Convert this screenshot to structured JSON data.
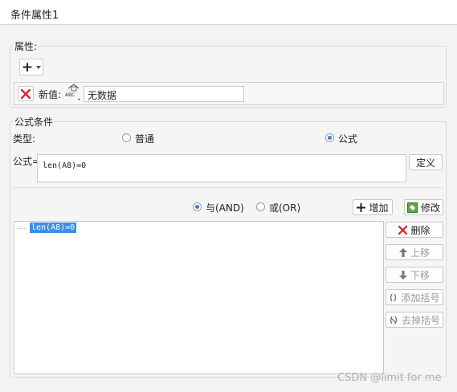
{
  "tab": {
    "title": "条件属性1"
  },
  "attributes": {
    "legend": "属性:",
    "add_symbol": "+",
    "new_value_label": "新值:",
    "value_type_badge": "ABC",
    "value": "无数据"
  },
  "formula_condition": {
    "legend": "公式条件",
    "type_label": "类型:",
    "type_options": [
      {
        "label": "普通",
        "checked": false
      },
      {
        "label": "公式",
        "checked": true
      }
    ],
    "formula_label": "公式=",
    "formula_value": "len(A8)=0",
    "define_button": "定义"
  },
  "logic": {
    "and_label": "与(AND)",
    "and_checked": true,
    "or_label": "或(OR)",
    "or_checked": false,
    "add_button": "增加",
    "modify_button": "修改"
  },
  "conditions_list": [
    "len(A8)=0"
  ],
  "side_buttons": {
    "delete": "删除",
    "move_up": "上移",
    "move_down": "下移",
    "add_bracket": "添加括号",
    "remove_bracket": "去掉括号"
  },
  "watermark": "CSDN @limit for me",
  "colors": {
    "accent": "#3a7bd5",
    "delete_red": "#d9232e",
    "selection": "#3d8ee6"
  }
}
